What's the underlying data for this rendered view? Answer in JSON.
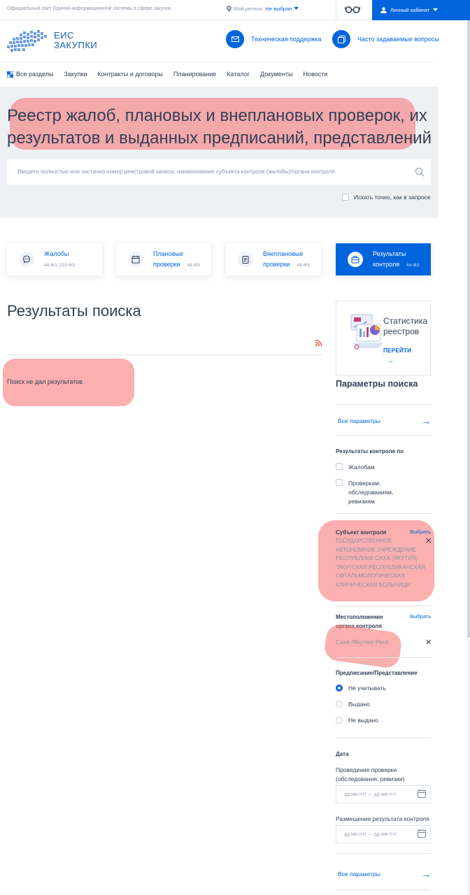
{
  "topbar": {
    "site_label": "Официальный сайт Единой информационной системы в сфере закупок",
    "region_label": "Мой регион:",
    "region_value": "Не выбран",
    "cabinet_label": "Личный кабинет"
  },
  "header": {
    "logo_line1": "ЕИС",
    "logo_line2": "ЗАКУПКИ",
    "support_label": "Техническая поддержка",
    "faq_label": "Часто задаваемые вопросы"
  },
  "nav": {
    "all_sections": "Все разделы",
    "items": [
      "Закупки",
      "Контракты и договоры",
      "Планирование",
      "Каталог",
      "Документы",
      "Новости"
    ]
  },
  "hero": {
    "title": "Реестр жалоб, плановых и внеплановых проверок, их результатов и выданных предписаний, представлений",
    "search_placeholder": "Введите полностью или частично номер реестровой записи, наименование субъекта контроля (жалобы)/органа контроля",
    "exact_label": "Искать точно, как в запросе"
  },
  "tabs": [
    {
      "line1": "Жалобы",
      "line2": "",
      "law": "44-ФЗ, 223-ФЗ"
    },
    {
      "line1": "Плановые",
      "line2": "проверки",
      "law": "44-ФЗ"
    },
    {
      "line1": "Внеплановые",
      "line2": "проверки",
      "law": "44-ФЗ"
    },
    {
      "line1": "Результаты",
      "line2": "контроля",
      "law": "44-ФЗ"
    }
  ],
  "results": {
    "title": "Результаты поиска",
    "empty": "Поиск не дал результатов"
  },
  "stat": {
    "title_line1": "Статистика",
    "title_line2": "реестров",
    "go": "ПЕРЕЙТИ"
  },
  "params": {
    "title": "Параметры поиска",
    "all_params": "Все параметры",
    "control_results_title": "Результаты контроля по",
    "control_results_options": [
      "Жалобам",
      "Проверкам, обследованиям, ревизиям"
    ],
    "subject_title": "Субъект контроля",
    "choose": "Выбрать",
    "subject_value": "ГОСУДАРСТВЕННОЕ АВТОНОМНОЕ УЧРЕЖДЕНИЕ РЕСПУБЛИКИ САХА (ЯКУТИЯ) \"ЯКУТСКАЯ РЕСПУБЛИКАНСКАЯ ОФТАЛЬМОЛОГИЧЕСКАЯ КЛИНИЧЕСКАЯ БОЛЬНИЦА\"",
    "location_title": "Местоположение органа контроля",
    "location_value": "Саха /Якутия/ Респ",
    "prescription_title": "Предписание/Представление",
    "prescription_options": [
      "Не учитывать",
      "Выдано",
      "Не выдано"
    ],
    "date_title": "Дата",
    "date_check_label": "Проведение проверки (обследования, ревизии)",
    "date_publish_label": "Размещение результата контроля",
    "date_placeholder": "дд.мм.гггг — дд.мм.гггг"
  }
}
